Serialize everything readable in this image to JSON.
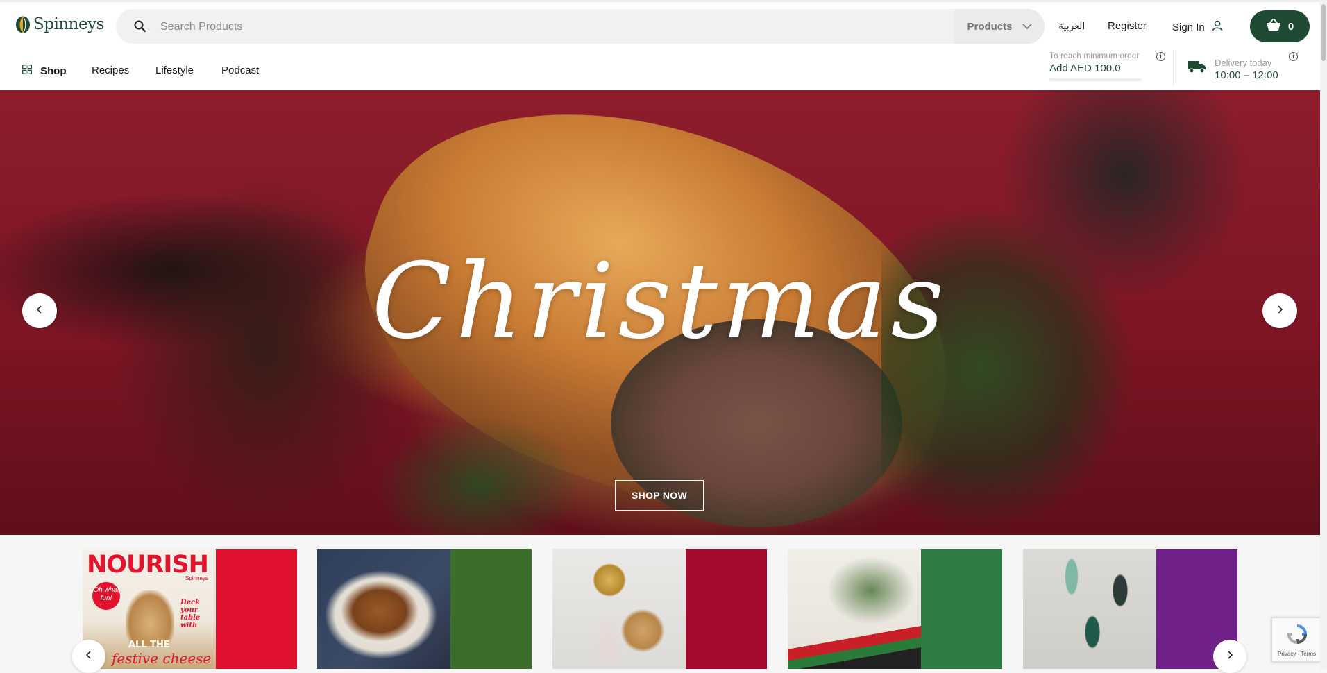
{
  "brand": {
    "name": "Spinneys",
    "logo_icon": "spinneys-leaf-logo",
    "color": "#1f4a34"
  },
  "search": {
    "placeholder": "Search Products",
    "filter_label": "Products"
  },
  "header": {
    "language_label": "العربية",
    "register_label": "Register",
    "signin_label": "Sign In",
    "cart_count": "0"
  },
  "nav": {
    "items": [
      {
        "label": "Shop",
        "icon": "grid-icon"
      },
      {
        "label": "Recipes"
      },
      {
        "label": "Lifestyle"
      },
      {
        "label": "Podcast"
      }
    ]
  },
  "min_order": {
    "label": "To reach minimum order",
    "value": "Add AED 100.0"
  },
  "delivery": {
    "label": "Delivery today",
    "value": "10:00 – 12:00"
  },
  "hero": {
    "title": "Christmas",
    "cta_label": "SHOP NOW"
  },
  "cards": [
    {
      "stripe_color": "#e0112e",
      "title": "NOURISH",
      "brand": "Spinneys",
      "badge": "Oh what fun!",
      "deck_text": "Deck your table with",
      "small_text": "ALL THE",
      "script": "festive cheese"
    },
    {
      "stripe_color": "#3b6e2a"
    },
    {
      "stripe_color": "#a30a2d"
    },
    {
      "stripe_color": "#2f7a45"
    },
    {
      "stripe_color": "#6f2189"
    }
  ],
  "recaptcha": {
    "label": "Privacy - Terms"
  }
}
